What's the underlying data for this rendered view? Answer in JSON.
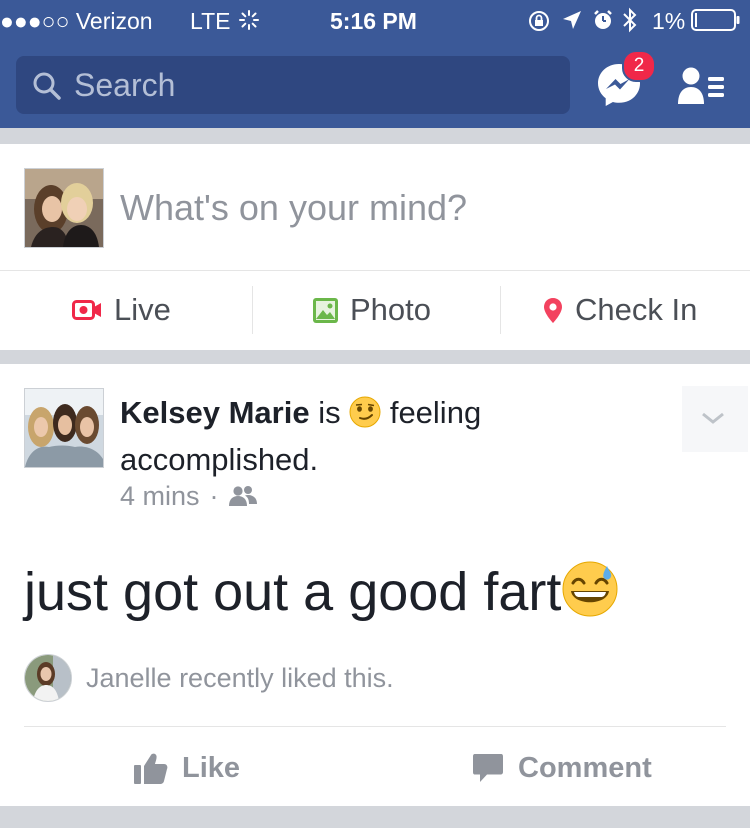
{
  "status_bar": {
    "carrier": "●●●○○ Verizon",
    "network": "LTE",
    "time": "5:16 PM",
    "battery": "1%"
  },
  "header": {
    "search_placeholder": "Search",
    "messenger_badge": "2"
  },
  "composer": {
    "prompt": "What's on your mind?",
    "actions": [
      {
        "label": "Live",
        "icon": "live-video-icon",
        "color": "#f02849"
      },
      {
        "label": "Photo",
        "icon": "photo-icon",
        "color": "#6bb74a"
      },
      {
        "label": "Check In",
        "icon": "location-pin-icon",
        "color": "#f3425f"
      }
    ]
  },
  "post": {
    "author": "Kelsey Marie",
    "verb": "is",
    "feeling": "feeling accomplished.",
    "time": "4 mins",
    "separator": "·",
    "audience_icon": "friends-icon",
    "text": "just got out a good fart",
    "liked_by": "Janelle recently liked this.",
    "like_label": "Like",
    "comment_label": "Comment"
  },
  "colors": {
    "brand_blue": "#3b5998",
    "search_bg": "#2f4780",
    "badge_red": "#f02849",
    "muted_text": "#90949c"
  }
}
